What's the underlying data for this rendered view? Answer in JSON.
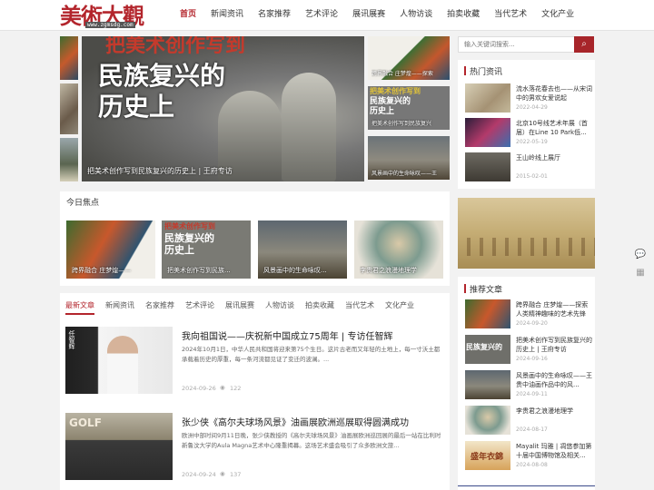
{
  "header": {
    "logo_text": "美術大觀",
    "logo_url": "www.zgmsdg.com",
    "nav": [
      "首页",
      "新闻资讯",
      "名家推荐",
      "艺术评论",
      "展讯展赛",
      "人物访谈",
      "拍卖收藏",
      "当代艺术",
      "文化产业"
    ]
  },
  "search": {
    "placeholder": "输入关键词搜索...",
    "icon": "search-icon"
  },
  "slider": {
    "main_caption": "把美术创作写到民族复兴的历史上 | 王府专访",
    "headline_top": "把美术创作写到",
    "headline_line1": "民族复兴的",
    "headline_line2": "历史上",
    "side": [
      {
        "caption": "跨界融合 庄梦煌——探索"
      },
      {
        "caption": "把美术创作写到民族复兴"
      },
      {
        "caption": "风景画中的生命咏叹——王"
      }
    ],
    "side_headline_top": "把美术创作写到",
    "side_headline_1": "民族复兴的",
    "side_headline_2": "历史上"
  },
  "focus": {
    "title": "今日焦点",
    "cards": [
      {
        "caption": "跨界融合 庄梦煌——"
      },
      {
        "caption": "把美术创作写到民族..."
      },
      {
        "caption": "风景画中的生命咏叹..."
      },
      {
        "caption": "李贵君之浪漫地理学"
      }
    ],
    "card2_headline": "把美术创作写到",
    "card2_line1": "民族复兴的",
    "card2_line2": "历史上"
  },
  "tabs": [
    "最新文章",
    "新闻资讯",
    "名家推荐",
    "艺术评论",
    "展讯展赛",
    "人物访谈",
    "拍卖收藏",
    "当代艺术",
    "文化产业"
  ],
  "articles": [
    {
      "title": "我向祖国说——庆祝新中国成立75周年 | 专访任智辉",
      "desc": "2024年10月1日，中华人民共和国将迎来第75个生日。这片古老而又年轻的土地上，每一寸沃土都承载着历史的厚重，每一条河流都见证了变迁的波澜。...",
      "date": "2024-09-26",
      "views": "122",
      "img_tag": "任智辉"
    },
    {
      "title": "张少侠《高尔夫球场风景》油画展欧洲巡展取得圆满成功",
      "desc": "欧洲中部时间9月11日晚，张少侠教授的《高尔夫球场风景》油画展欧洲巡回展的最后一站在比利时新鲁汶大学的Aula Magna艺术中心隆重揭幕。这场艺术盛会吸引了众多欧洲文旅...",
      "date": "2024-09-24",
      "views": "137",
      "img_tag": "GOLF"
    }
  ],
  "hot": {
    "title": "热门资讯",
    "items": [
      {
        "title": "流水落花春去也——从宋词中的男欢女爱说起",
        "date": "2022-04-29"
      },
      {
        "title": "北京10号线艺术年展（首届）在Line 10 Park低...",
        "date": "2022-05-19"
      },
      {
        "title": "王山岭线上展厅",
        "date": "2015-02-01"
      }
    ]
  },
  "recommend": {
    "title": "推荐文章",
    "items": [
      {
        "title": "跨界融合 庄梦煌——探索人类精神趣味的艺术先锋",
        "date": "2024-09-20"
      },
      {
        "title": "把美术创作写到民族复兴的历史上 | 王府专访",
        "date": "2024-09-16"
      },
      {
        "title": "风景画中的生命咏叹——王贵中油画作品中的风...",
        "date": "2024-09-11"
      },
      {
        "title": "李贵君之浪漫地理学",
        "date": "2024-08-17"
      },
      {
        "title": "Mayalit 玛雅 | 凋悠参加第十届中国博物馆及相关...",
        "date": "2024-08-08"
      }
    ],
    "item2_headline": "民族复兴的",
    "item5_text": "盛年衣錦"
  },
  "float_icons": [
    "chat-icon",
    "qrcode-icon"
  ],
  "colors": {
    "accent": "#b3252c",
    "button": "#a7252a"
  }
}
